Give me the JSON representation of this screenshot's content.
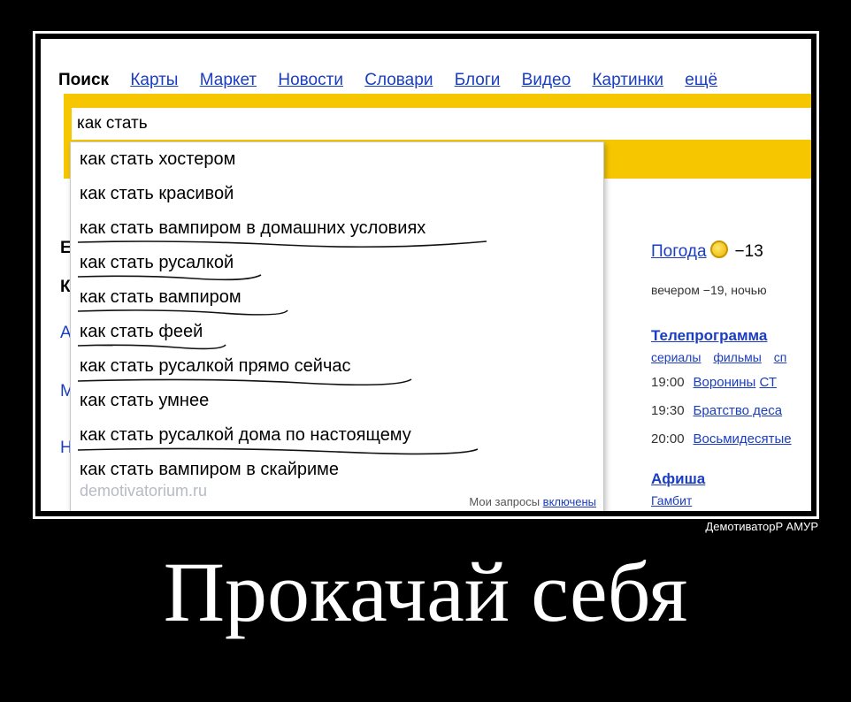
{
  "nav": {
    "current": "Поиск",
    "links": [
      "Карты",
      "Маркет",
      "Новости",
      "Словари",
      "Блоги",
      "Видео",
      "Картинки",
      "ещё"
    ]
  },
  "search": {
    "value": "как стать"
  },
  "suggestions": [
    "как стать хостером",
    "как стать красивой",
    "как стать вампиром в домашних условиях",
    "как стать русалкой",
    "как стать вампиром",
    "как стать феей",
    "как стать русалкой прямо сейчас",
    "как стать умнее",
    "как стать русалкой дома по настоящему",
    "как стать вампиром в скайриме"
  ],
  "suggest_footer": {
    "text": "Мои запросы",
    "link": "включены"
  },
  "watermark": "demotivatorium.ru",
  "weather": {
    "title": "Погода",
    "temp": "−13",
    "subtitle": "вечером −19, ночью"
  },
  "tv": {
    "title": "Телепрограмма",
    "categories": [
      "сериалы",
      "фильмы",
      "сп"
    ],
    "rows": [
      {
        "time": "19:00",
        "program": "Воронины",
        "extra": "СТ"
      },
      {
        "time": "19:30",
        "program": "Братство деса",
        "extra": ""
      },
      {
        "time": "20:00",
        "program": "Восьмидесятые",
        "extra": ""
      }
    ]
  },
  "afisha": {
    "title": "Афиша",
    "item": "Гамбит"
  },
  "credit": "ДемотиваторP АМУР",
  "caption": "Прокачай себя",
  "colors": {
    "link": "#1a3dc1",
    "band": "#f6c700",
    "background": "#000000"
  }
}
